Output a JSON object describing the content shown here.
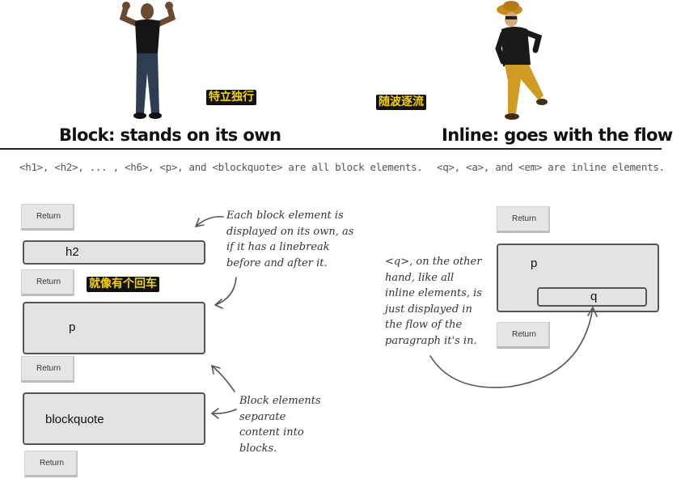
{
  "block_side": {
    "label_cn": "特立独行",
    "heading": "Block: stands on its own",
    "caption": "<h1>, <h2>, ... , <h6>, <p>, and <blockquote> are all block elements.",
    "return_label": "Return",
    "h2_label": "h2",
    "p_label": "p",
    "blockquote_label": "blockquote",
    "linebreak_cn": "就像有个回车",
    "note_top": [
      "Each block element is",
      "displayed on its own, as",
      "if it has a linebreak",
      "before and after it."
    ],
    "note_bottom": [
      "Block elements",
      "separate",
      "content into",
      "blocks."
    ]
  },
  "inline_side": {
    "label_cn": "随波逐流",
    "heading": "Inline: goes with the flow",
    "caption": "<q>, <a>, and <em> are inline elements.",
    "return_label": "Return",
    "p_label": "p",
    "q_label": "q",
    "note": [
      "<q>, on the other",
      "hand, like all",
      "inline elements, is",
      "just displayed in",
      "the flow of the",
      "paragraph it's in."
    ]
  }
}
